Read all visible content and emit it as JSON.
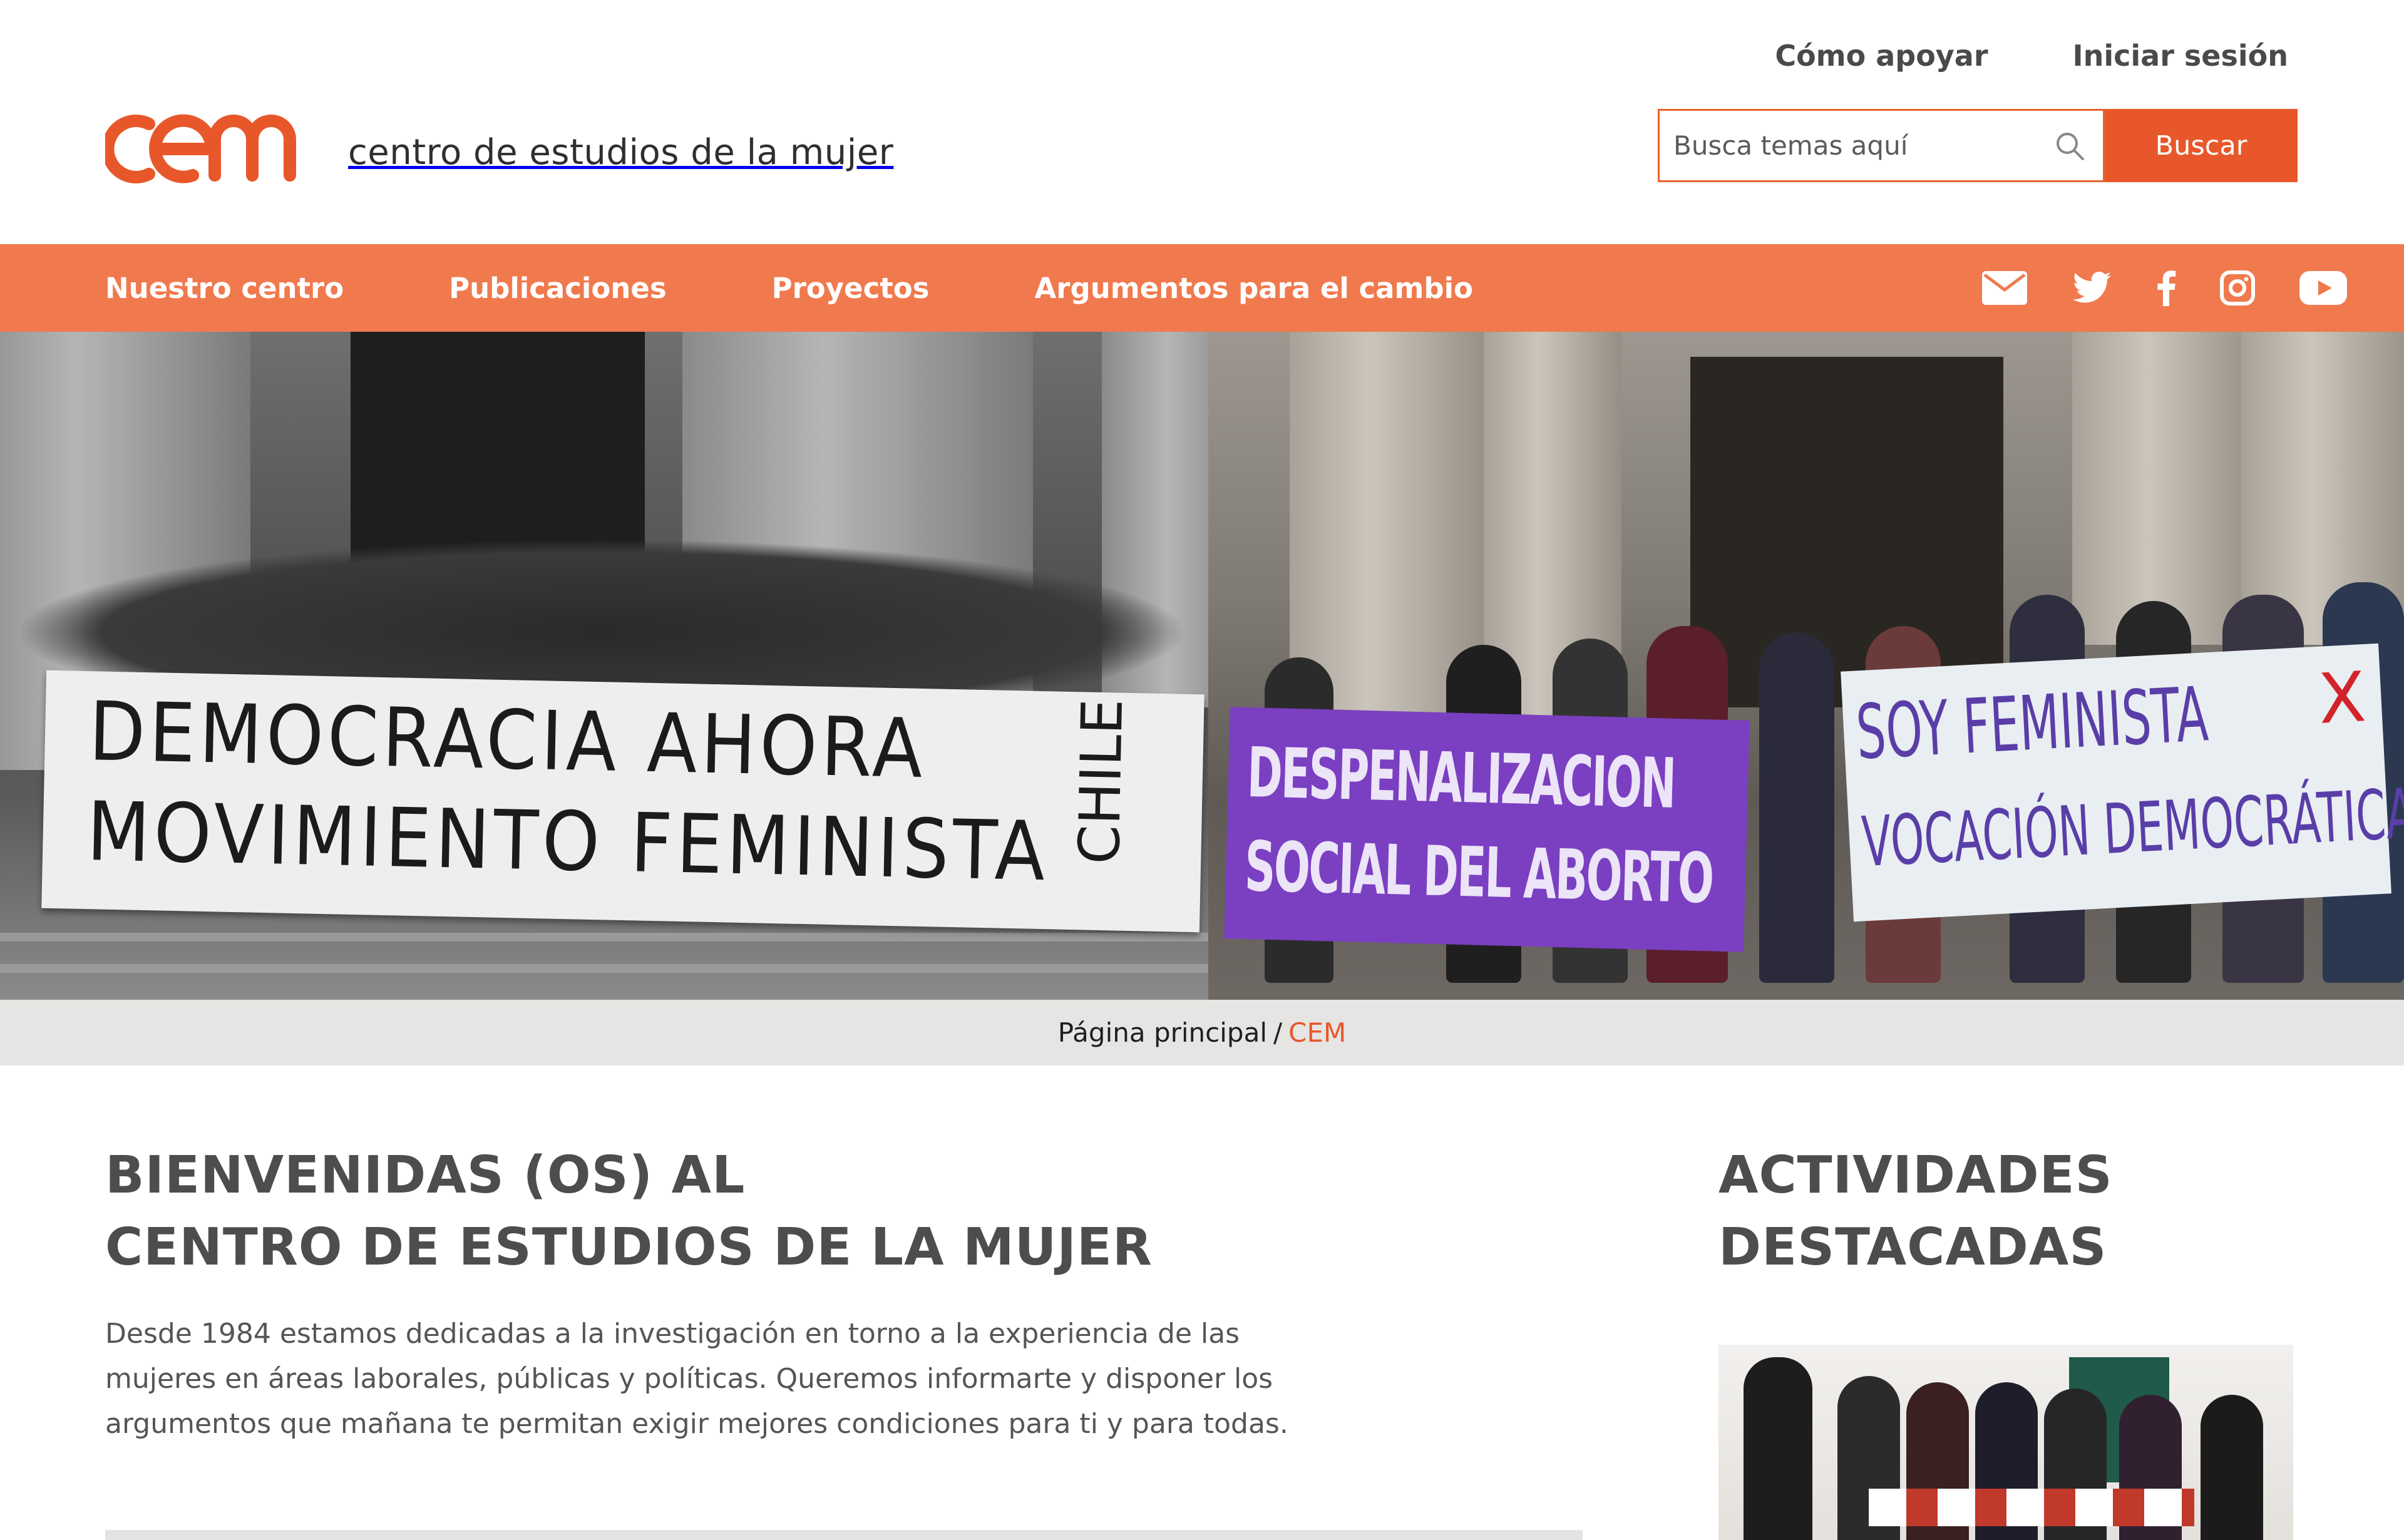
{
  "header": {
    "logo_text": "centro de estudios de la mujer",
    "top_links": [
      "Cómo apoyar",
      "Iniciar sesión"
    ],
    "search": {
      "placeholder": "Busca temas aquí",
      "button_label": "Buscar"
    }
  },
  "nav": {
    "items": [
      "Nuestro centro",
      "Publicaciones",
      "Proyectos",
      "Argumentos para el cambio"
    ],
    "social_icons": [
      "mail-icon",
      "twitter-icon",
      "facebook-icon",
      "instagram-icon",
      "youtube-icon"
    ]
  },
  "hero": {
    "left_banner": {
      "line1": "DEMOCRACIA AHORA",
      "line2": "MOVIMIENTO FEMINISTA",
      "side": "CHILE"
    },
    "purple_banner": {
      "line1": "DESPENALIZACION",
      "line2": "SOCIAL DEL ABORTO"
    },
    "white_banner": {
      "line1": "SOY FEMINISTA",
      "mark": "X",
      "line2": "VOCACIÓN DEMOCRÁTICA"
    }
  },
  "breadcrumb": {
    "home": "Página principal",
    "separator": "/",
    "current": "CEM"
  },
  "main": {
    "title_line1": "BIENVENIDAS (OS) AL",
    "title_line2": "CENTRO DE ESTUDIOS DE LA MUJER",
    "intro": "Desde 1984 estamos dedicadas a la investigación en torno a la experiencia de las mujeres en áreas laborales, públicas y políticas. Queremos informarte y disponer los argumentos que mañana te permitan exigir mejores condiciones para ti y para todas."
  },
  "sidebar": {
    "title_line1": "ACTIVIDADES",
    "title_line2": "DESTACADAS"
  },
  "colors": {
    "accent": "#e8572a",
    "nav": "#f07a4e",
    "breadcrumb_bg": "#e6e5e3",
    "heading": "#4d4d4d"
  }
}
